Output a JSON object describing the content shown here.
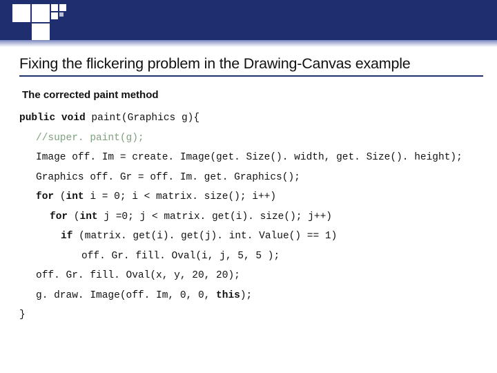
{
  "title": "Fixing the flickering problem in the Drawing-Canvas example",
  "subtitle": "The corrected paint method",
  "code": {
    "l0a": "public void",
    "l0b": " paint(Graphics g){",
    "l1": "//super. paint(g);",
    "l2": "Image off. Im = create. Image(get. Size(). width, get. Size(). height);",
    "l3": "Graphics off. Gr = off. Im. get. Graphics();",
    "l4a": "for",
    "l4b": " (",
    "l4c": "int",
    "l4d": " i = 0; i < matrix. size(); i++)",
    "l5a": "for",
    "l5b": " (",
    "l5c": "int",
    "l5d": " j =0; j < matrix. get(i). size(); j++)",
    "l6a": "if",
    "l6b": " (matrix. get(i). get(j). int. Value() == 1)",
    "l7": "off. Gr. fill. Oval(i, j, 5, 5 );",
    "l8": "off. Gr. fill. Oval(x, y, 20, 20);",
    "l9a": "g. draw. Image(off. Im, 0, 0, ",
    "l9b": "this",
    "l9c": ");",
    "l10": "}"
  }
}
